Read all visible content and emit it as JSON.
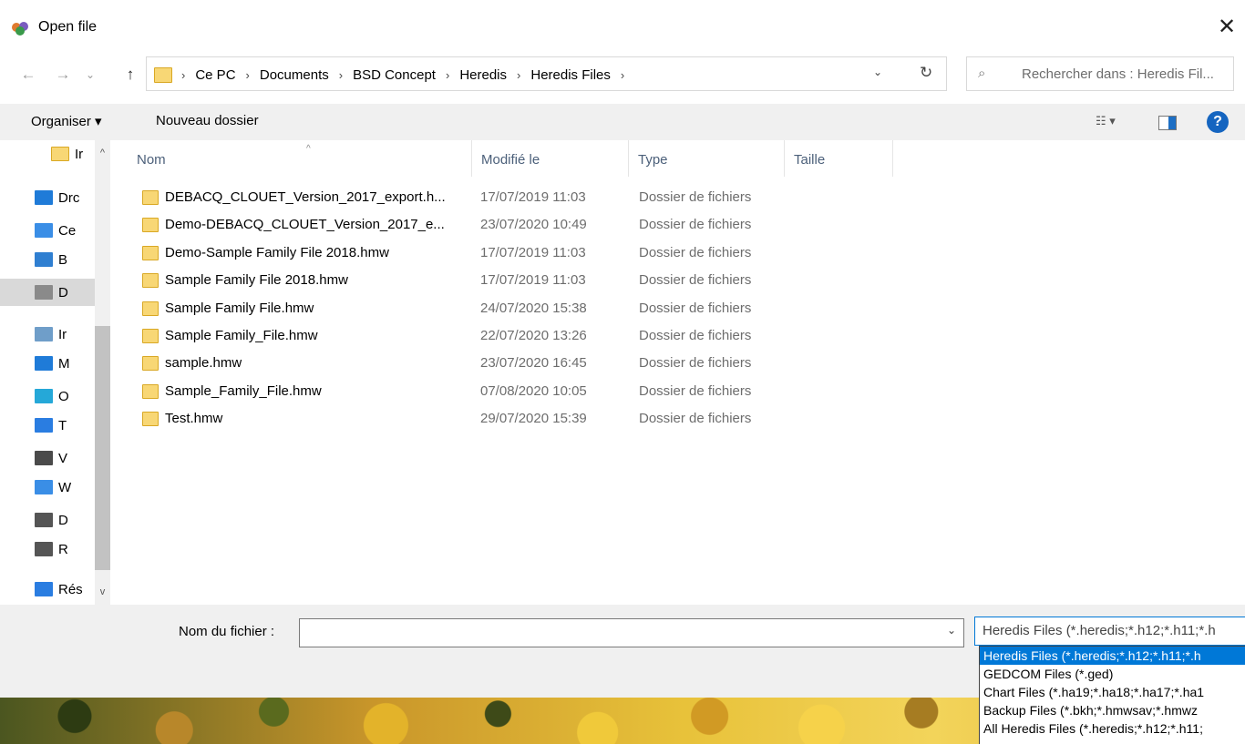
{
  "window": {
    "title": "Open file",
    "close_label": "✕"
  },
  "nav": {
    "breadcrumbs": [
      "Ce PC",
      "Documents",
      "BSD Concept",
      "Heredis",
      "Heredis Files"
    ],
    "search_placeholder": "Rechercher dans : Heredis Fil..."
  },
  "toolbar": {
    "organize_label": "Organiser ▾",
    "new_folder_label": "Nouveau dossier",
    "help_label": "?"
  },
  "sidebar": {
    "items": [
      {
        "label": "Ir",
        "icon": "folder-icon",
        "color": "#f8d775"
      },
      {
        "label": "Drc",
        "icon": "dropbox-icon",
        "color": "#1f7bd8"
      },
      {
        "label": "Ce",
        "icon": "computer-icon",
        "color": "#3a8ee6"
      },
      {
        "label": "B",
        "icon": "desktop-icon",
        "color": "#2f7fd1"
      },
      {
        "label": "D",
        "icon": "documents-icon",
        "color": "#8a8a8a"
      },
      {
        "label": "Ir",
        "icon": "pictures-icon",
        "color": "#6f9ec9"
      },
      {
        "label": "M",
        "icon": "music-icon",
        "color": "#1f7bd8"
      },
      {
        "label": "O",
        "icon": "3d-objects-icon",
        "color": "#25a8d8"
      },
      {
        "label": "T",
        "icon": "downloads-icon",
        "color": "#2a7de1"
      },
      {
        "label": "V",
        "icon": "videos-icon",
        "color": "#4a4a4a"
      },
      {
        "label": "W",
        "icon": "windows-drive-icon",
        "color": "#3a8ee6"
      },
      {
        "label": "D",
        "icon": "drive-icon",
        "color": "#555555"
      },
      {
        "label": "R",
        "icon": "drive-icon",
        "color": "#555555"
      },
      {
        "label": "Rés",
        "icon": "network-icon",
        "color": "#2a7de1"
      }
    ]
  },
  "filelist": {
    "columns": {
      "name": "Nom",
      "modified": "Modifié le",
      "type": "Type",
      "size": "Taille"
    },
    "rows": [
      {
        "name": "DEBACQ_CLOUET_Version_2017_export.h...",
        "modified": "17/07/2019 11:03",
        "type": "Dossier de fichiers"
      },
      {
        "name": "Demo-DEBACQ_CLOUET_Version_2017_e...",
        "modified": "23/07/2020 10:49",
        "type": "Dossier de fichiers"
      },
      {
        "name": "Demo-Sample Family File 2018.hmw",
        "modified": "17/07/2019 11:03",
        "type": "Dossier de fichiers"
      },
      {
        "name": "Sample Family File 2018.hmw",
        "modified": "17/07/2019 11:03",
        "type": "Dossier de fichiers"
      },
      {
        "name": "Sample Family File.hmw",
        "modified": "24/07/2020 15:38",
        "type": "Dossier de fichiers"
      },
      {
        "name": "Sample Family_File.hmw",
        "modified": "22/07/2020 13:26",
        "type": "Dossier de fichiers"
      },
      {
        "name": "sample.hmw",
        "modified": "23/07/2020 16:45",
        "type": "Dossier de fichiers"
      },
      {
        "name": "Sample_Family_File.hmw",
        "modified": "07/08/2020 10:05",
        "type": "Dossier de fichiers"
      },
      {
        "name": "Test.hmw",
        "modified": "29/07/2020 15:39",
        "type": "Dossier de fichiers"
      }
    ]
  },
  "bottom": {
    "filename_label": "Nom du fichier :",
    "filename_value": "",
    "filetype_selected": "Heredis Files  (*.heredis;*.h12;*.h11;*.h",
    "filetype_options": [
      "Heredis Files  (*.heredis;*.h12;*.h11;*.h",
      "GEDCOM Files (*.ged)",
      "Chart Files  (*.ha19;*.ha18;*.ha17;*.ha1",
      "Backup Files  (*.bkh;*.hmwsav;*.hmwz",
      "All Heredis Files (*.heredis;*.h12;*.h11;"
    ]
  },
  "colors": {
    "accent": "#0078d7",
    "folder": "#f8d775",
    "selection": "#d9d9d9"
  }
}
